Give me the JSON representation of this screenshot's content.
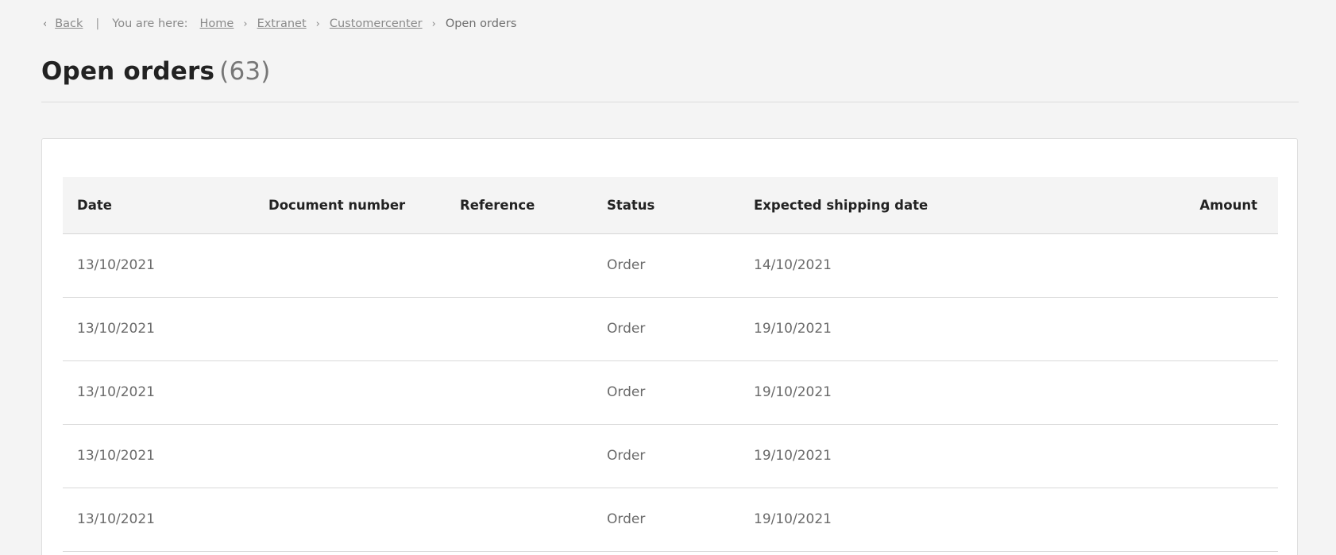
{
  "breadcrumb": {
    "back_label": "Back",
    "you_are_here": "You are here:",
    "items": [
      "Home",
      "Extranet",
      "Customercenter"
    ],
    "current": "Open orders"
  },
  "page": {
    "title": "Open orders",
    "count": "(63)"
  },
  "table": {
    "headers": {
      "date": "Date",
      "document_number": "Document number",
      "reference": "Reference",
      "status": "Status",
      "expected_shipping_date": "Expected shipping date",
      "amount": "Amount"
    },
    "rows": [
      {
        "date": "13/10/2021",
        "document_number": "",
        "reference": "",
        "status": "Order",
        "expected_shipping_date": "14/10/2021",
        "amount": ""
      },
      {
        "date": "13/10/2021",
        "document_number": "",
        "reference": "",
        "status": "Order",
        "expected_shipping_date": "19/10/2021",
        "amount": ""
      },
      {
        "date": "13/10/2021",
        "document_number": "",
        "reference": "",
        "status": "Order",
        "expected_shipping_date": "19/10/2021",
        "amount": ""
      },
      {
        "date": "13/10/2021",
        "document_number": "",
        "reference": "",
        "status": "Order",
        "expected_shipping_date": "19/10/2021",
        "amount": ""
      },
      {
        "date": "13/10/2021",
        "document_number": "",
        "reference": "",
        "status": "Order",
        "expected_shipping_date": "19/10/2021",
        "amount": ""
      }
    ]
  }
}
